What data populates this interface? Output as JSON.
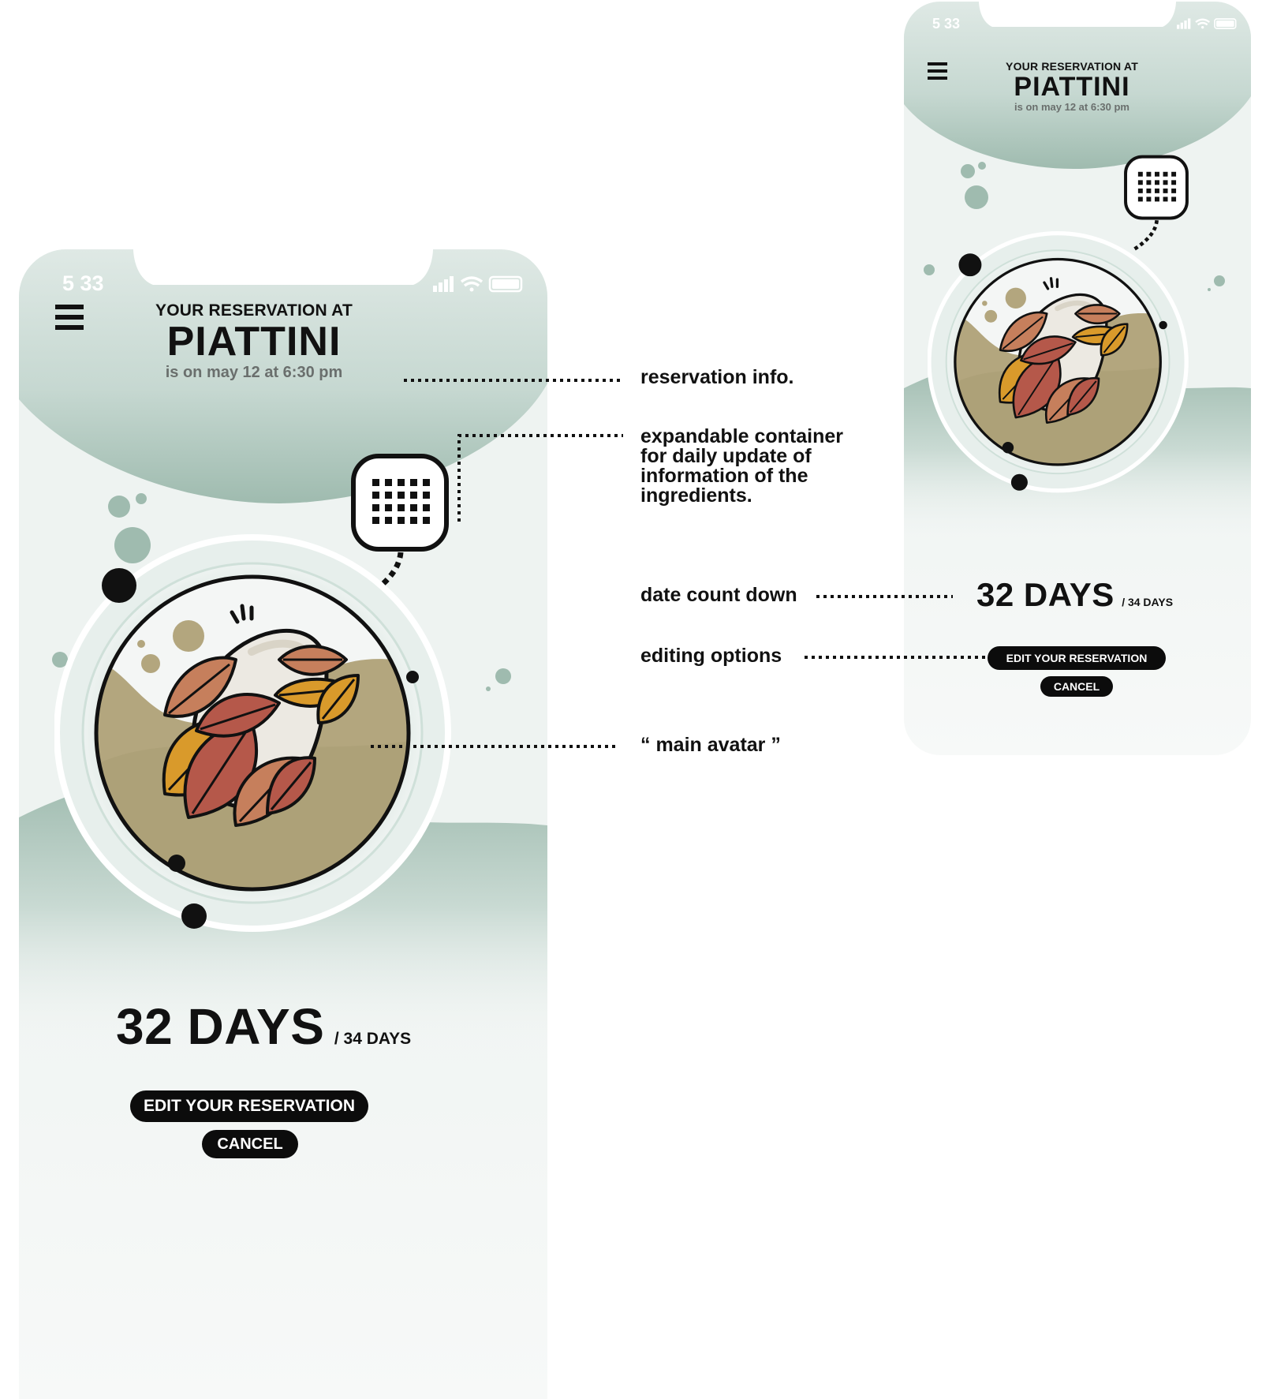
{
  "status": {
    "time": "5 33"
  },
  "header": {
    "pre_title": "YOUR RESERVATION AT",
    "restaurant": "PIATTINI",
    "subtitle": "is on may 12 at 6:30 pm"
  },
  "countdown": {
    "days": "32 DAYS",
    "total": "/ 34 DAYS"
  },
  "buttons": {
    "edit": "EDIT YOUR RESERVATION",
    "cancel": "CANCEL"
  },
  "annotations": {
    "reservation_info": "reservation info.",
    "expandable": [
      "expandable container",
      "for daily update of",
      "information of the",
      "ingredients."
    ],
    "date_count_down": "date count down",
    "editing_options": "editing options",
    "main_avatar": "“ main avatar ”"
  },
  "icons": {
    "menu": "hamburger-menu-icon",
    "info": "grid-dots-icon",
    "signal": "signal-icon",
    "wifi": "wifi-icon",
    "battery": "battery-icon"
  },
  "colors": {
    "sage": "#9fbbaf",
    "sage_light": "#dfe9e5",
    "khaki": "#b3a67e",
    "leaf_red": "#b5584a",
    "leaf_orange": "#d99a2b",
    "leaf_brown": "#c67f5c",
    "button": "#0c0c0c"
  }
}
